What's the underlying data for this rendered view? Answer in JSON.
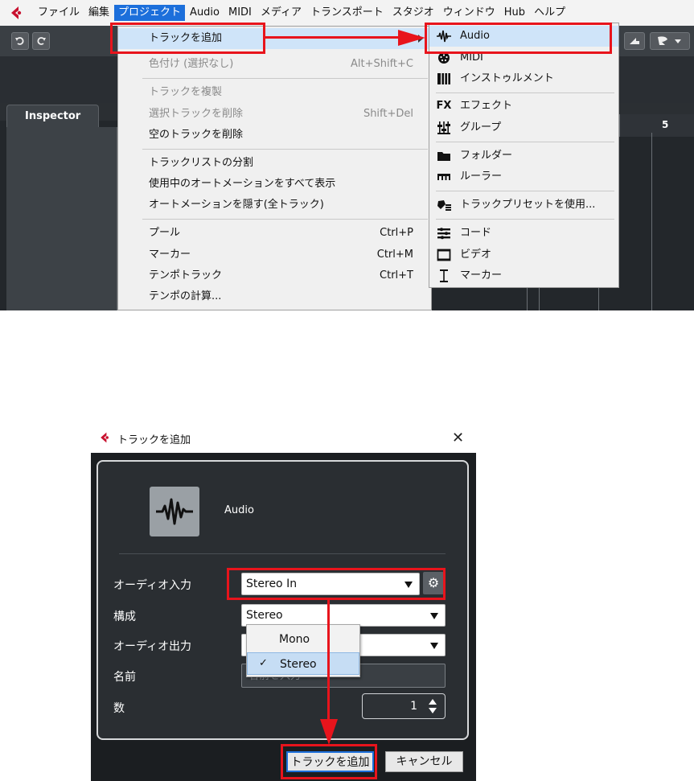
{
  "menubar": {
    "items": [
      "ファイル",
      "編集",
      "プロジェクト",
      "Audio",
      "MIDI",
      "メディア",
      "トランスポート",
      "スタジオ",
      "ウィンドウ",
      "Hub",
      "ヘルプ"
    ],
    "active_index": 2
  },
  "toolbar": {
    "undo_icon": "undo-icon",
    "redo_icon": "redo-icon"
  },
  "inspector": {
    "tab_label": "Inspector"
  },
  "ruler": {
    "bar_number": "5"
  },
  "project_menu": {
    "items": [
      {
        "label": "トラックを追加",
        "shortcut": "",
        "state": "highlighted",
        "submenu": true
      },
      {
        "label": "色付け (選択なし)",
        "shortcut": "Alt+Shift+C",
        "state": "disabled"
      },
      {
        "label": "トラックを複製",
        "shortcut": "",
        "state": "disabled"
      },
      {
        "label": "選択トラックを削除",
        "shortcut": "Shift+Del",
        "state": "disabled"
      },
      {
        "label": "空のトラックを削除",
        "shortcut": "",
        "state": "normal"
      },
      {
        "label": "トラックリストの分割",
        "shortcut": "",
        "state": "normal"
      },
      {
        "label": "使用中のオートメーションをすべて表示",
        "shortcut": "",
        "state": "normal"
      },
      {
        "label": "オートメーションを隠す(全トラック)",
        "shortcut": "",
        "state": "normal"
      },
      {
        "label": "プール",
        "shortcut": "Ctrl+P",
        "state": "normal"
      },
      {
        "label": "マーカー",
        "shortcut": "Ctrl+M",
        "state": "normal"
      },
      {
        "label": "テンポトラック",
        "shortcut": "Ctrl+T",
        "state": "normal"
      },
      {
        "label": "テンポの計算...",
        "shortcut": "",
        "state": "normal"
      }
    ]
  },
  "add_track_submenu": {
    "items": [
      {
        "label": "Audio",
        "icon": "waveform-icon",
        "glyph": "",
        "state": "highlighted"
      },
      {
        "label": "MIDI",
        "icon": "midi-port-icon",
        "glyph": "",
        "state": "normal"
      },
      {
        "label": "インストゥルメント",
        "icon": "piano-keys-icon",
        "glyph": "",
        "state": "normal"
      },
      {
        "label": "エフェクト",
        "icon": "fx-icon",
        "glyph": "FX",
        "state": "normal"
      },
      {
        "label": "グループ",
        "icon": "group-faders-icon",
        "glyph": "",
        "state": "normal"
      },
      {
        "label": "フォルダー",
        "icon": "folder-icon",
        "glyph": "",
        "state": "normal"
      },
      {
        "label": "ルーラー",
        "icon": "ruler-icon",
        "glyph": "",
        "state": "normal"
      },
      {
        "label": "トラックプリセットを使用...",
        "icon": "track-preset-icon",
        "glyph": "",
        "state": "normal"
      },
      {
        "label": "コード",
        "icon": "chord-icon",
        "glyph": "",
        "state": "normal"
      },
      {
        "label": "ビデオ",
        "icon": "video-icon",
        "glyph": "",
        "state": "normal"
      },
      {
        "label": "マーカー",
        "icon": "marker-icon",
        "glyph": "",
        "state": "normal"
      }
    ]
  },
  "dialog": {
    "title": "トラックを追加",
    "close_glyph": "✕",
    "track_type": "Audio",
    "audio_input": {
      "label": "オーディオ入力",
      "value": "Stereo In"
    },
    "configuration": {
      "label": "構成",
      "value": "Stereo",
      "options": [
        "Mono",
        "Stereo"
      ],
      "selected": "Stereo"
    },
    "audio_output": {
      "label": "オーディオ出力",
      "value": ""
    },
    "name": {
      "label": "名前",
      "placeholder": "名前を入力"
    },
    "count": {
      "label": "数",
      "value": "1"
    },
    "ok_label": "トラックを追加",
    "cancel_label": "キャンセル",
    "check_glyph": "✓",
    "gear_glyph": "⚙"
  },
  "colors": {
    "highlight": "#cfe4f9",
    "annotation_red": "#e8141c",
    "active_menu": "#1c6fdb",
    "dark_panel": "#2a2e32"
  }
}
